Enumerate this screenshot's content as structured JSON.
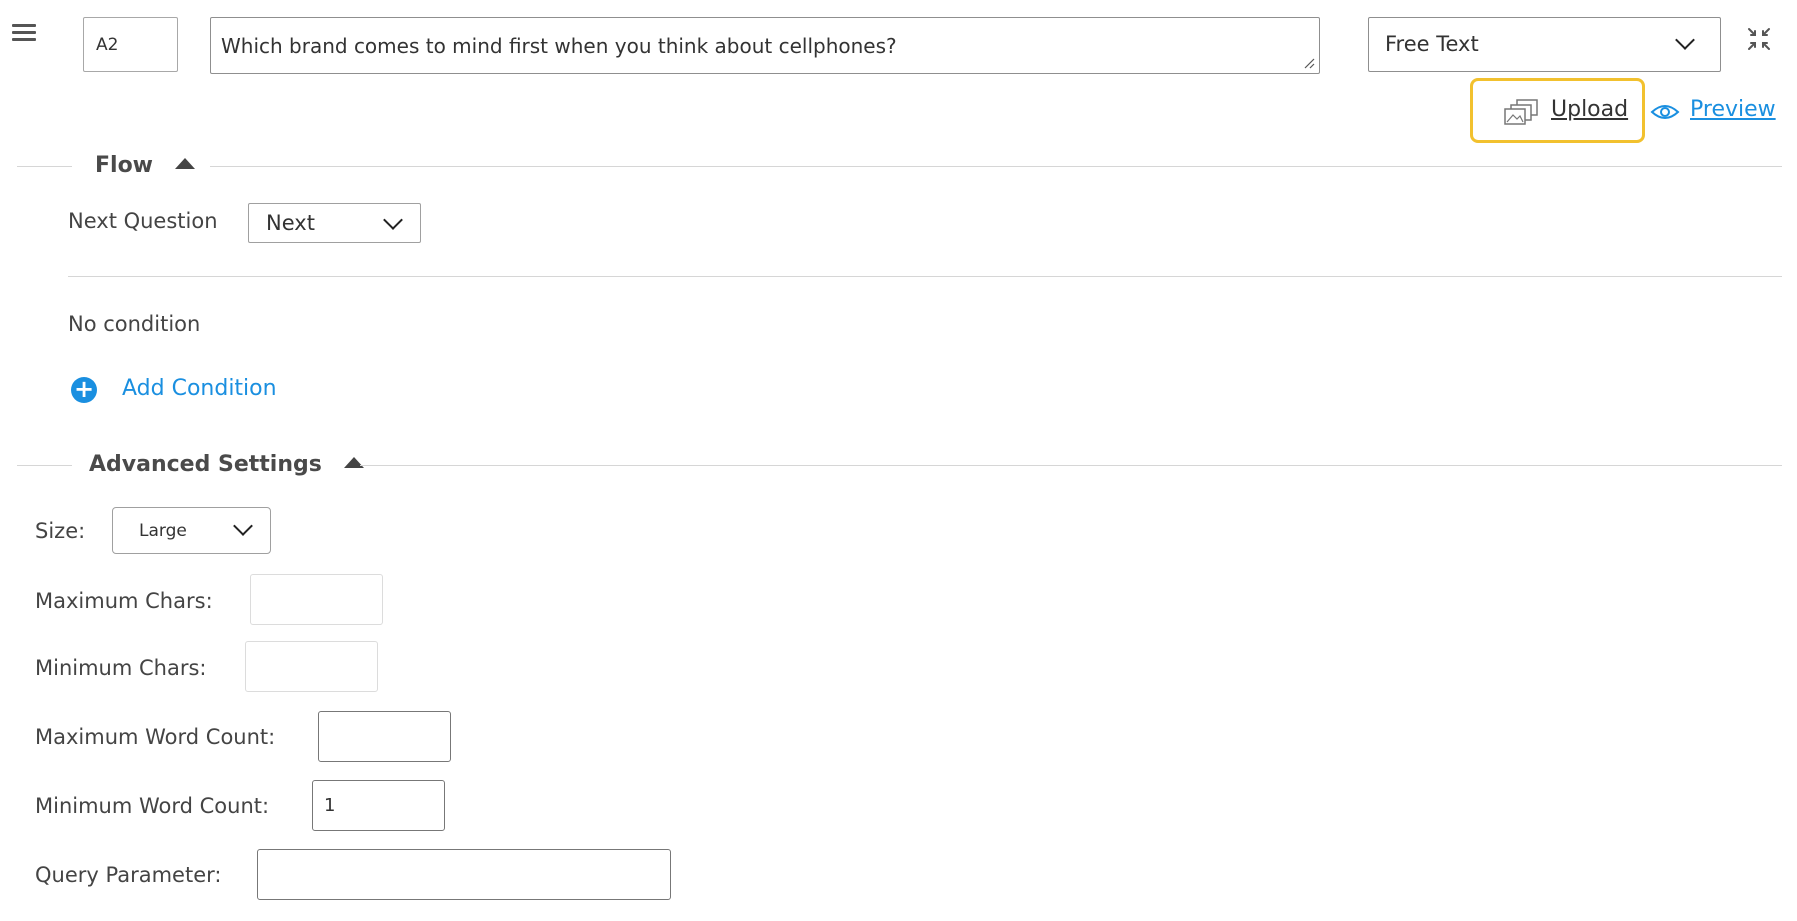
{
  "header": {
    "menu_icon": "hamburger-menu-icon",
    "question_id": "A2",
    "question_text": "Which brand comes to mind first when you think about cellphones?",
    "question_type": "Free Text",
    "collapse_icon": "collapse-arrows-icon"
  },
  "actions": {
    "upload_label": "Upload",
    "upload_icon": "upload-images-icon",
    "preview_label": "Preview",
    "preview_icon": "eye-icon",
    "highlight_color": "#f2c12e",
    "link_color": "#1a8fe0"
  },
  "flow": {
    "title": "Flow",
    "next_question_label": "Next Question",
    "next_question_value": "Next",
    "no_condition_text": "No condition",
    "add_condition_label": "Add Condition"
  },
  "advanced": {
    "title": "Advanced Settings",
    "size_label": "Size:",
    "size_value": "Large",
    "max_chars_label": "Maximum Chars:",
    "max_chars_value": "",
    "min_chars_label": "Minimum Chars:",
    "min_chars_value": "",
    "max_words_label": "Maximum Word Count:",
    "max_words_value": "",
    "min_words_label": "Minimum Word Count:",
    "min_words_value": "1",
    "query_param_label": "Query Parameter:",
    "query_param_value": ""
  }
}
